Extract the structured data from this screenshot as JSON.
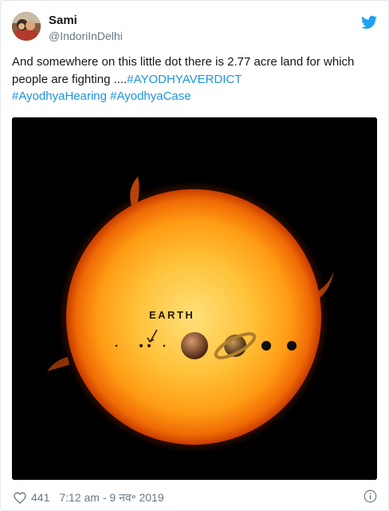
{
  "user": {
    "name": "Sami",
    "handle": "@IndoriInDelhi"
  },
  "tweet": {
    "text_before": "And somewhere on this little dot there is 2.77 acre land for which people are fighting ....",
    "hashtags": [
      "#AYODHYAVERDICT",
      "#AyodhyaHearing",
      "#AyodhyaCase"
    ]
  },
  "media": {
    "label": "EARTH"
  },
  "footer": {
    "likes": "441",
    "timestamp": "7:12 am - 9 नव॰ 2019"
  },
  "icons": {
    "brand": "twitter-bird-icon",
    "like": "heart-icon",
    "info": "info-icon"
  },
  "colors": {
    "accent": "#1b95e0",
    "brand": "#1da1f2",
    "muted": "#657786",
    "text": "#14171a"
  }
}
